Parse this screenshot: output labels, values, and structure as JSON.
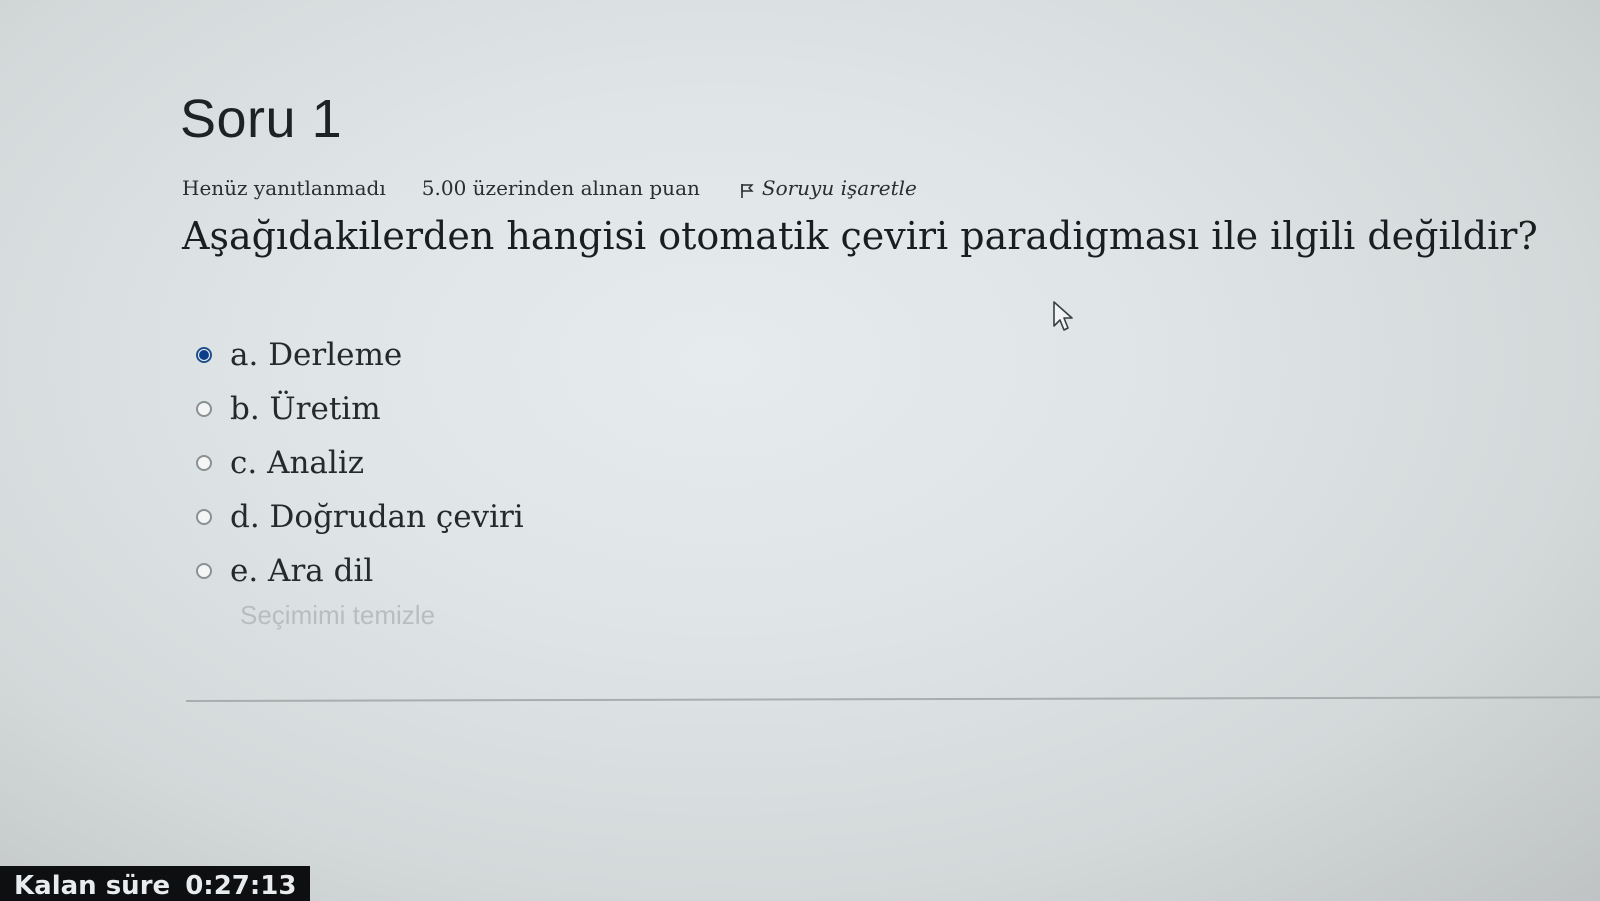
{
  "question": {
    "title": "Soru 1",
    "status": "Henüz yanıtlanmadı",
    "grade": "5.00 üzerinden alınan puan",
    "flag_label": "Soruyu işaretle",
    "text": "Aşağıdakilerden hangisi otomatik çeviri paradigması ile ilgili değildir?",
    "answers": [
      {
        "label": "a. Derleme",
        "selected": true
      },
      {
        "label": "b. Üretim",
        "selected": false
      },
      {
        "label": "c. Analiz",
        "selected": false
      },
      {
        "label": "d. Doğrudan çeviri",
        "selected": false
      },
      {
        "label": "e. Ara dil",
        "selected": false
      }
    ],
    "clear_label": "Seçimimi temizle"
  },
  "timer": {
    "label": "Kalan süre",
    "value": "0:27:13"
  },
  "colors": {
    "radio_selected": "#0d3e8a",
    "timer_background": "#0d0f10"
  },
  "icons": {
    "flag": "flag-icon",
    "cursor": "mouse-pointer-icon"
  }
}
